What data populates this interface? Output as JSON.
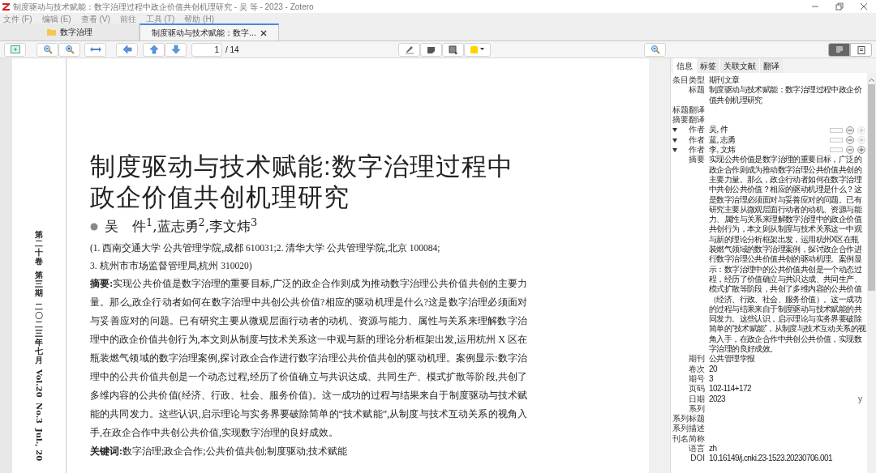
{
  "window": {
    "title": "制度驱动与技术赋能：数字治理过程中政企价值共创机理研究 - 吴 等 - 2023 - Zotero",
    "menu": [
      "文件 (F)",
      "编辑 (E)",
      "查看 (V)",
      "前往",
      "工具 (T)",
      "帮助 (H)"
    ]
  },
  "tabs": [
    {
      "label": "数字治理",
      "kind": "library",
      "selected": false
    },
    {
      "label": "制度驱动与技术赋能：数字...",
      "kind": "reader",
      "selected": true
    }
  ],
  "toolbar": {
    "page": "1",
    "page_total": "/ 14",
    "view_toggles": [
      {
        "kind": "info",
        "selected": true
      },
      {
        "kind": "notes",
        "selected": false
      }
    ]
  },
  "document": {
    "margin_texts": [
      {
        "text": "第二十卷",
        "kind": "cjk"
      },
      {
        "text": "第三期",
        "kind": "cjk"
      },
      {
        "text": "二〇二三年七月",
        "kind": "cjk"
      },
      {
        "text": "Vol.20",
        "kind": "latin"
      },
      {
        "text": "No.3",
        "kind": "latin"
      },
      {
        "text": "Jul., 20",
        "kind": "latin"
      }
    ],
    "title_lines": [
      "制度驱动与技术赋能:数字治理过程中",
      "政企价值共创机理研究"
    ],
    "authors": "吴　件$^{1}$,蓝志勇$^{2}$,李文炜$^{3}$",
    "affiliations": [
      "(1. 西南交通大学 公共管理学院,成都 610031;2. 清华大学 公共管理学院,北京 100084;",
      "3. 杭州市市场监督管理局,杭州 310020)"
    ],
    "abstract": "**摘要:**实现公共价值是数字治理的重要目标,广泛的政企合作则成为推动数字治理公共价值共创的主要力量。那么,政企行动者如何在数字治理中共创公共价值?相应的驱动机理是什么?这是数字治理必须面对与妥善应对的问题。已有研究主要从微观层面行动者的动机、资源与能力、属性与关系来理解数字治理中的政企价值共创行为,本文则从制度与技术关系这一中观与新的理论分析框架出发,运用杭州 X 区在瓶装燃气领域的数字治理案例,探讨政企合作进行数字治理公共价值共创的驱动机理。案例显示:数字治理中的公共价值共创是一个动态过程,经历了价值确立与共识达成、共同生产、模式扩散等阶段,共创了多维内容的公共价值(经济、行政、社会、服务价值)。这一成功的过程与结果来自于制度驱动与技术赋能的共同发力。这些认识,启示理论与实务界要破除简单的“技术赋能”,从制度与技术互动关系的视角入手,在政企合作中共创公共价值,实现数字治理的良好成效。",
    "keywords": "**关键词:**数字治理;政企合作;公共价值共创;制度驱动;技术赋能"
  },
  "panel": {
    "tabs": [
      {
        "label": "信息",
        "selected": true
      },
      {
        "label": "标签",
        "selected": false
      },
      {
        "label": "关联文献",
        "selected": false
      },
      {
        "label": "翻译",
        "selected": false
      }
    ],
    "fields": [
      {
        "kind": "text",
        "label": "条目类型",
        "value": "期刊文章"
      },
      {
        "kind": "text",
        "label": "标题",
        "value": "制度驱动与技术赋能：数字治理过程中政企价值共创机理研究"
      },
      {
        "kind": "text",
        "label": "标题翻译"
      },
      {
        "kind": "text",
        "label": "摘要翻译"
      },
      {
        "kind": "creator",
        "label": "作者",
        "value": "吴, 件",
        "add_enabled": false
      },
      {
        "kind": "creator",
        "label": "作者",
        "value": "蓝, 志勇",
        "add_enabled": false
      },
      {
        "kind": "creator",
        "label": "作者",
        "value": "李, 文炜",
        "add_enabled": true
      },
      {
        "kind": "text",
        "label": "摘要",
        "value": "实现公共价值是数字治理的重要目标，广泛的政企合作则成为推动数字治理公共价值共创的主要力量。那么，政企行动者如何在数字治理中共创公共价值？相应的驱动机理是什么？这是数字治理必须面对与妥善应对的问题。已有研究主要从微观层面行动者的动机、资源与能力、属性与关系来理解数字治理中的政企价值共创行为，本文则从制度与技术关系这一中观与新的理论分析框架出发，运用杭州X区在瓶装燃气领域的数字治理案例，探讨政企合作进行数字治理公共价值共创的驱动机理。案例显示：数字治理中的公共价值共创是一个动态过程，经历了价值确立与共识达成、共同生产、模式扩散等阶段，共创了多维内容的公共价值（经济、行政、社会、服务价值）。这一成功的过程与结果来自于制度驱动与技术赋能的共同发力。这些认识，启示理论与实务界要破除简单的“技术赋能”，从制度与技术互动关系的视角入手，在政企合作中共创公共价值，实现数字治理的良好成效。"
      },
      {
        "kind": "text",
        "label": "期刊",
        "value": "公共管理学报"
      },
      {
        "kind": "text",
        "label": "卷次",
        "value": "20"
      },
      {
        "kind": "text",
        "label": "期号",
        "value": "3"
      },
      {
        "kind": "text",
        "label": "页码",
        "value": "102-114+172"
      },
      {
        "kind": "date",
        "label": "日期",
        "value": "2023",
        "suffix": "y"
      },
      {
        "kind": "text",
        "label": "系列"
      },
      {
        "kind": "text",
        "label": "系列标题"
      },
      {
        "kind": "text",
        "label": "系列描述"
      },
      {
        "kind": "text",
        "label": "刊名简称"
      },
      {
        "kind": "text",
        "label": "语言",
        "value": "zh"
      },
      {
        "kind": "text",
        "label": "DOI",
        "value": "10.16149/j.cnki.23-1523.20230706.001"
      }
    ]
  }
}
